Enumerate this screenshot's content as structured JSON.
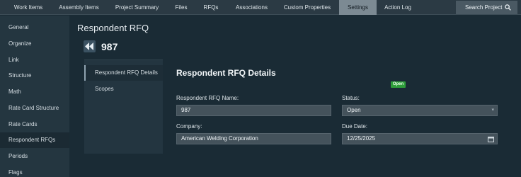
{
  "topnav": {
    "tabs": [
      {
        "label": "Work Items"
      },
      {
        "label": "Assembly Items"
      },
      {
        "label": "Project Summary"
      },
      {
        "label": "Files"
      },
      {
        "label": "RFQs"
      },
      {
        "label": "Associations"
      },
      {
        "label": "Custom Properties"
      },
      {
        "label": "Settings",
        "active": true
      },
      {
        "label": "Action Log"
      }
    ],
    "search_label": "Search Project",
    "search_icon": "search-icon",
    "active_color": "#7c8a93"
  },
  "sidebar": {
    "items": [
      {
        "label": "General"
      },
      {
        "label": "Organize"
      },
      {
        "label": "Link"
      },
      {
        "label": "Structure"
      },
      {
        "label": "Math"
      },
      {
        "label": "Rate Card Structure"
      },
      {
        "label": "Rate Cards"
      },
      {
        "label": "Respondent RFQs",
        "active": true
      },
      {
        "label": "Periods"
      },
      {
        "label": "Flags"
      }
    ]
  },
  "main": {
    "title": "Respondent RFQ",
    "back_icon": "double-chevron-left-icon",
    "record_id": "987"
  },
  "subnav": {
    "items": [
      {
        "label": "Respondent RFQ Details",
        "active": true
      },
      {
        "label": "Scopes"
      }
    ]
  },
  "details": {
    "title": "Respondent RFQ Details",
    "name_label": "Respondent RFQ Name:",
    "name_value": "987",
    "status_label": "Status:",
    "status_badge": "Open",
    "status_badge_color": "#2e9e3a",
    "status_value": "Open",
    "company_label": "Company:",
    "company_value": "American Welding Corporation",
    "due_label": "Due Date:",
    "due_value": "12/25/2025"
  }
}
